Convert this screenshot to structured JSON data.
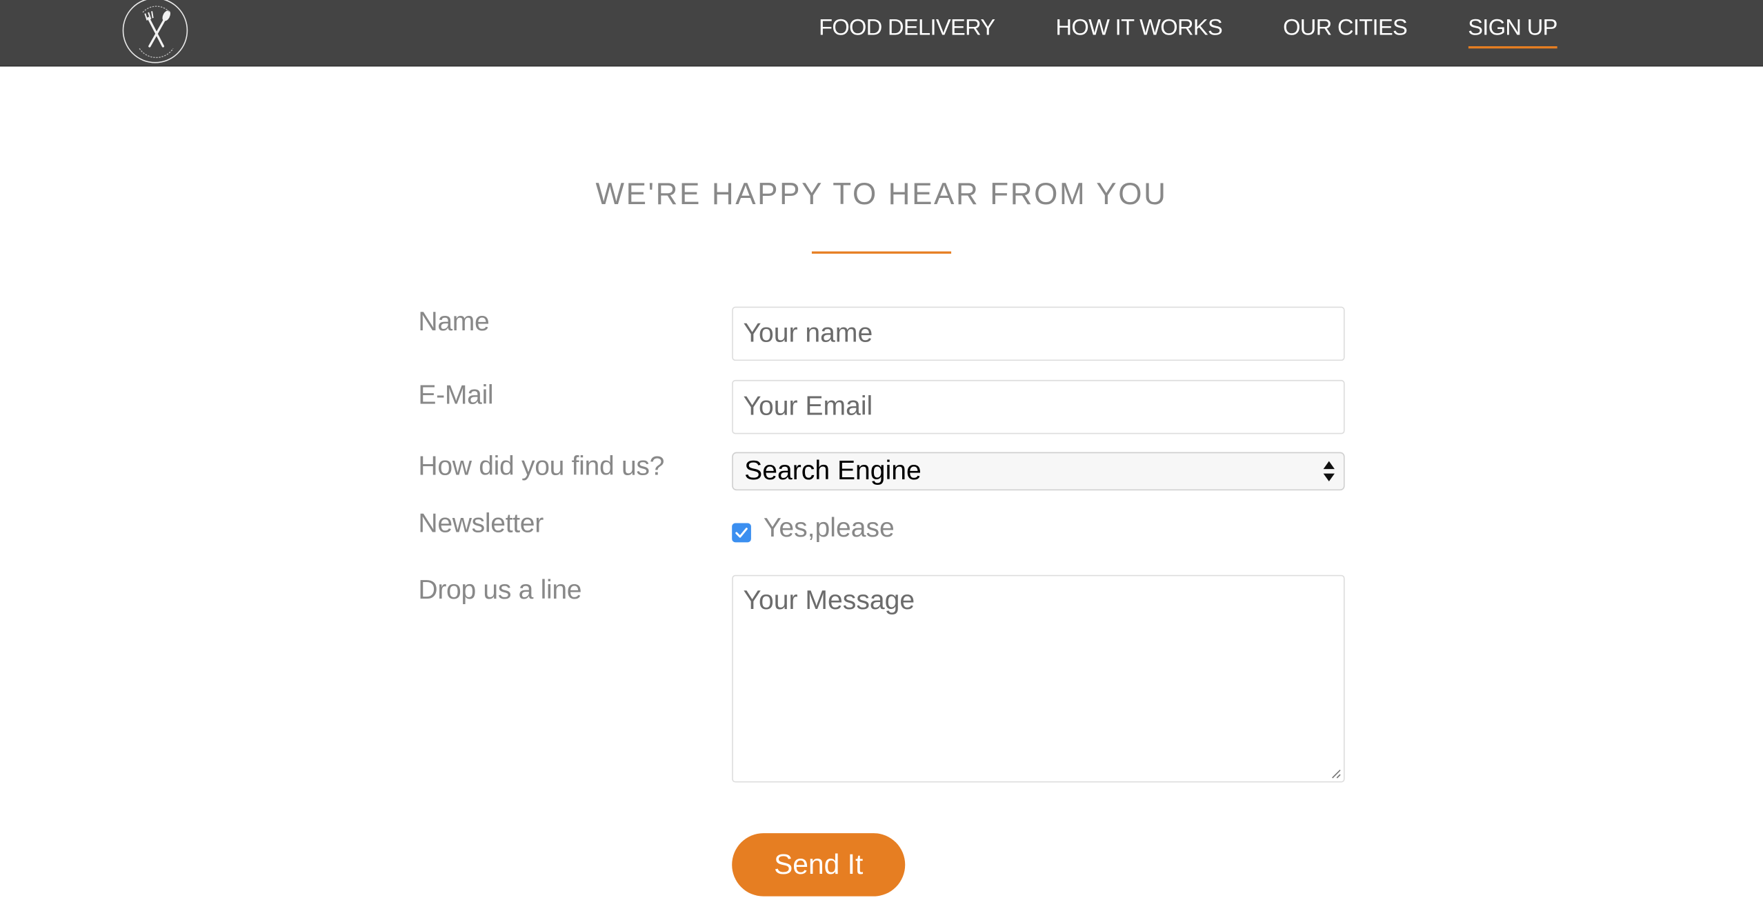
{
  "nav": {
    "logo_alt": "OMNIFOOD",
    "links": [
      {
        "label": "FOOD DELIVERY"
      },
      {
        "label": "HOW IT WORKS"
      },
      {
        "label": "OUR CITIES"
      },
      {
        "label": "SIGN UP",
        "active": true
      }
    ]
  },
  "section": {
    "title": "WE'RE HAPPY TO HEAR FROM YOU"
  },
  "form": {
    "name_label": "Name",
    "name_placeholder": "Your name",
    "email_label": "E-Mail",
    "email_placeholder": "Your Email",
    "find_label": "How did you find us?",
    "find_selected": "Search Engine",
    "newsletter_label": "Newsletter",
    "newsletter_option": "Yes,please",
    "newsletter_checked": true,
    "message_label": "Drop us a line",
    "message_placeholder": "Your Message",
    "submit_label": "Send It"
  },
  "colors": {
    "accent": "#e67e22",
    "nav_bg": "#444444",
    "label_text": "#888888",
    "checkbox": "#3b8ff0"
  },
  "icons": {
    "logo": "fork-and-spoon-icon",
    "select": "select-arrows-icon",
    "checkbox": "checkmark-icon",
    "textarea": "resize-grip-icon"
  }
}
